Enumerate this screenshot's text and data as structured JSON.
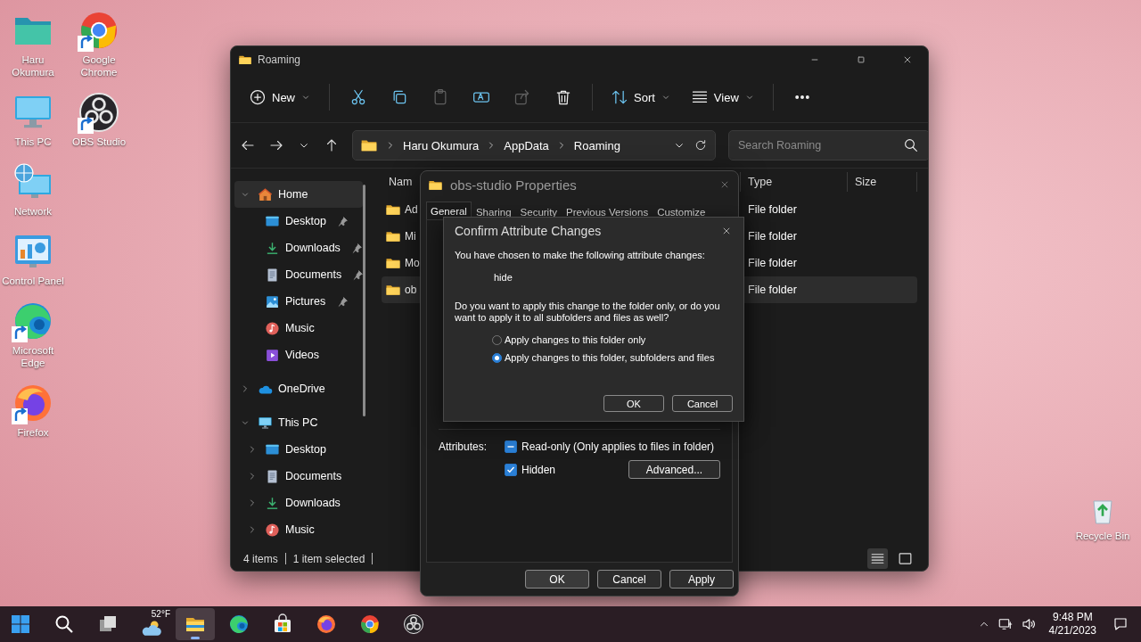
{
  "desktop": {
    "icons": [
      {
        "kind": "user-folder",
        "label": "Haru Okumura",
        "shortcut": false
      },
      {
        "kind": "this-pc",
        "label": "This PC",
        "shortcut": false
      },
      {
        "kind": "network",
        "label": "Network",
        "shortcut": false
      },
      {
        "kind": "control-panel",
        "label": "Control Panel",
        "shortcut": false
      },
      {
        "kind": "edge",
        "label": "Microsoft Edge",
        "shortcut": true
      },
      {
        "kind": "firefox",
        "label": "Firefox",
        "shortcut": true
      },
      {
        "kind": "chrome",
        "label": "Google Chrome",
        "shortcut": true
      },
      {
        "kind": "obs",
        "label": "OBS Studio",
        "shortcut": true
      }
    ],
    "recycle_bin": {
      "label": "Recycle Bin"
    }
  },
  "explorer": {
    "title": "Roaming",
    "toolbar": [
      {
        "kind": "new",
        "label": "New",
        "disabled": false
      },
      {
        "kind": "cut",
        "disabled": false
      },
      {
        "kind": "copy",
        "disabled": false
      },
      {
        "kind": "paste",
        "disabled": true
      },
      {
        "kind": "rename",
        "disabled": false
      },
      {
        "kind": "share",
        "disabled": true
      },
      {
        "kind": "delete",
        "disabled": false
      },
      {
        "kind": "sort",
        "label": "Sort",
        "disabled": false
      },
      {
        "kind": "view",
        "label": "View",
        "disabled": false
      },
      {
        "kind": "more",
        "disabled": false
      }
    ],
    "breadcrumb": [
      "Haru Okumura",
      "AppData",
      "Roaming"
    ],
    "search": {
      "placeholder": "Search Roaming"
    },
    "nav": [
      {
        "kind": "home",
        "label": "Home",
        "expanded": true,
        "selected": true,
        "children": [
          {
            "kind": "desktop",
            "label": "Desktop",
            "pinned": true,
            "selected": false
          },
          {
            "kind": "downloads",
            "label": "Downloads",
            "pinned": true,
            "selected": false
          },
          {
            "kind": "documents",
            "label": "Documents",
            "pinned": true,
            "selected": false
          },
          {
            "kind": "pictures",
            "label": "Pictures",
            "pinned": true,
            "selected": false
          },
          {
            "kind": "music",
            "label": "Music",
            "pinned": false,
            "selected": false
          },
          {
            "kind": "videos",
            "label": "Videos",
            "pinned": false,
            "selected": false
          }
        ]
      },
      {
        "kind": "onedrive",
        "label": "OneDrive",
        "expanded": false,
        "selected": false
      },
      {
        "kind": "pc",
        "label": "This PC",
        "expanded": true,
        "selected": false,
        "children": [
          {
            "kind": "desktop",
            "label": "Desktop",
            "expanded": false,
            "pinned": false,
            "selected": false
          },
          {
            "kind": "documents",
            "label": "Documents",
            "expanded": false,
            "pinned": false,
            "selected": false
          },
          {
            "kind": "downloads",
            "label": "Downloads",
            "expanded": false,
            "pinned": false,
            "selected": false
          },
          {
            "kind": "music",
            "label": "Music",
            "expanded": false,
            "pinned": false,
            "selected": false
          }
        ]
      }
    ],
    "columns": [
      "Nam",
      "Type",
      "Size"
    ],
    "rows": [
      {
        "name": "Ad",
        "type": "File folder",
        "selected": false
      },
      {
        "name": "Mi",
        "type": "File folder",
        "selected": false
      },
      {
        "name": "Mo",
        "type": "File folder",
        "selected": false
      },
      {
        "name": "ob",
        "type": "File folder",
        "selected": true
      }
    ],
    "status": {
      "count": "4 items",
      "selection": "1 item selected"
    },
    "view_modes": [
      {
        "kind": "details",
        "selected": true
      },
      {
        "kind": "tiles",
        "selected": false
      }
    ]
  },
  "properties": {
    "title": "obs-studio Properties",
    "tabs": [
      {
        "label": "General",
        "selected": true
      },
      {
        "label": "Sharing",
        "selected": false
      },
      {
        "label": "Security",
        "selected": false
      },
      {
        "label": "Previous Versions",
        "selected": false
      },
      {
        "label": "Customize",
        "selected": false
      }
    ],
    "attributes_label": "Attributes:",
    "attributes": [
      {
        "label": "Read-only (Only applies to files in folder)",
        "checked": false,
        "indeterminate": true
      },
      {
        "label": "Hidden",
        "checked": true,
        "indeterminate": false
      }
    ],
    "advanced_button": "Advanced...",
    "buttons": [
      "OK",
      "Cancel",
      "Apply"
    ]
  },
  "confirm": {
    "title": "Confirm Attribute Changes",
    "message": "You have chosen to make the following attribute changes:",
    "change": "hide",
    "question": "Do you want to apply this change to the folder only, or do you want to apply it to all subfolders and files as well?",
    "options": [
      {
        "label": "Apply changes to this folder only",
        "selected": false
      },
      {
        "label": "Apply changes to this folder, subfolders and files",
        "selected": true
      }
    ],
    "buttons": [
      "OK",
      "Cancel"
    ]
  },
  "taskbar": {
    "apps": [
      {
        "kind": "start",
        "active": false
      },
      {
        "kind": "search",
        "active": false
      },
      {
        "kind": "task-view",
        "active": false
      },
      {
        "kind": "weather",
        "label": "52°F",
        "active": false
      },
      {
        "kind": "explorer",
        "active": true
      },
      {
        "kind": "edge",
        "active": false
      },
      {
        "kind": "store",
        "active": false
      },
      {
        "kind": "firefox",
        "active": false
      },
      {
        "kind": "chrome",
        "active": false
      },
      {
        "kind": "obs",
        "active": false
      }
    ],
    "time": "9:48 PM",
    "date": "4/21/2023"
  }
}
